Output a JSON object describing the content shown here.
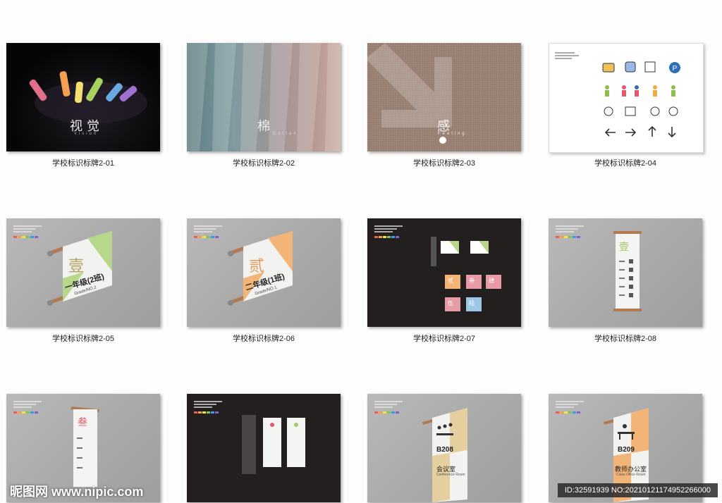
{
  "tiles": [
    {
      "caption": "学校标识标牌2-01",
      "word": "视觉",
      "sub": "Vision"
    },
    {
      "caption": "学校标识标牌2-02",
      "word": "棉",
      "sub": "Cotton"
    },
    {
      "caption": "学校标识标牌2-03",
      "word": "感",
      "sub": "Feeling"
    },
    {
      "caption": "学校标识标牌2-04"
    },
    {
      "caption": "学校标识标牌2-05",
      "numeral": "壹",
      "grade": "一年级(2班)",
      "grade_en": "Grade/NO.2"
    },
    {
      "caption": "学校标识标牌2-06",
      "numeral": "贰",
      "grade": "二年级(1班)",
      "grade_en": "Grade/NO.1"
    },
    {
      "caption": "学校标识标牌2-07",
      "labels": [
        "贰",
        "叁",
        "肆",
        "伍",
        "陆"
      ]
    },
    {
      "caption": "学校标识标牌2-08",
      "numeral": "壹"
    },
    {
      "caption": "",
      "numeral": "叁"
    },
    {
      "caption": ""
    },
    {
      "caption": "",
      "room": "B208",
      "room_name": "会议室",
      "room_en": "Conference Room"
    },
    {
      "caption": "",
      "room": "B209",
      "room_name": "教师办公室",
      "room_en": "Class Office Room"
    }
  ],
  "watermark": "昵图网 www.nipic.com",
  "image_id": "ID:32591939 NO:20210121174952266000",
  "colors": {
    "green": "#b7d88a",
    "orange": "#f3b477",
    "beige": "#e6cf9e",
    "pink": "#e89aa6",
    "blue": "#9cc8e6"
  }
}
